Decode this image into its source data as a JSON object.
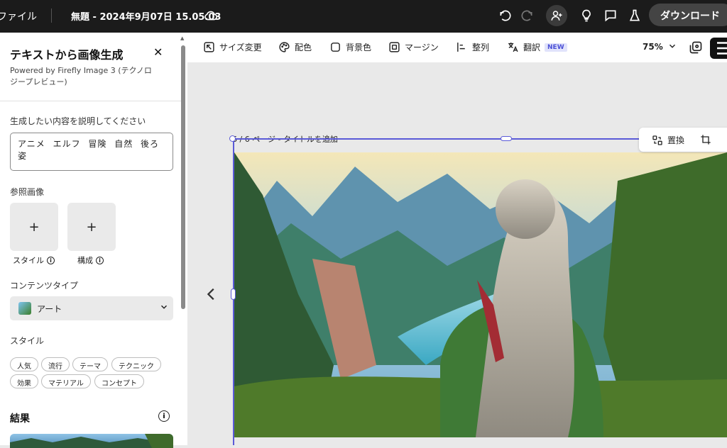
{
  "topbar": {
    "file_menu": "ファイル",
    "doc_title": "無題 - 2024年9月07日 15.05.03",
    "download_label": "ダウンロード"
  },
  "sidebar": {
    "title": "テキストから画像生成",
    "close_glyph": "✕",
    "subtitle": "Powered by Firefly Image 3 (テクノロジープレビュー)",
    "prompt_label": "生成したい内容を説明してください",
    "prompt_value": "アニメ エルフ 冒険 自然 後ろ姿",
    "reference_label": "参照画像",
    "references": [
      {
        "plus": "+",
        "caption": "スタイル"
      },
      {
        "plus": "+",
        "caption": "構成"
      }
    ],
    "content_type_label": "コンテンツタイプ",
    "content_type_value": "アート",
    "style_label": "スタイル",
    "style_chips": [
      "人気",
      "流行",
      "テーマ",
      "テクニック",
      "効果",
      "マテリアル",
      "コンセプト"
    ],
    "results_label": "結果",
    "info_glyph": "i"
  },
  "toolbar": {
    "resize": "サイズ変更",
    "color": "配色",
    "background": "背景色",
    "margin": "マージン",
    "align": "整列",
    "translate": "翻訳",
    "new_badge": "NEW",
    "zoom": "75%"
  },
  "canvas": {
    "page_label": "6 / 6 ページ - タイトルを追加",
    "replace_label": "置換",
    "prev_glyph": "‹"
  },
  "colors": {
    "accent": "#5a5ad8",
    "topbar_bg": "#1b1b1b",
    "canvas_bg": "#e9e9e9"
  }
}
